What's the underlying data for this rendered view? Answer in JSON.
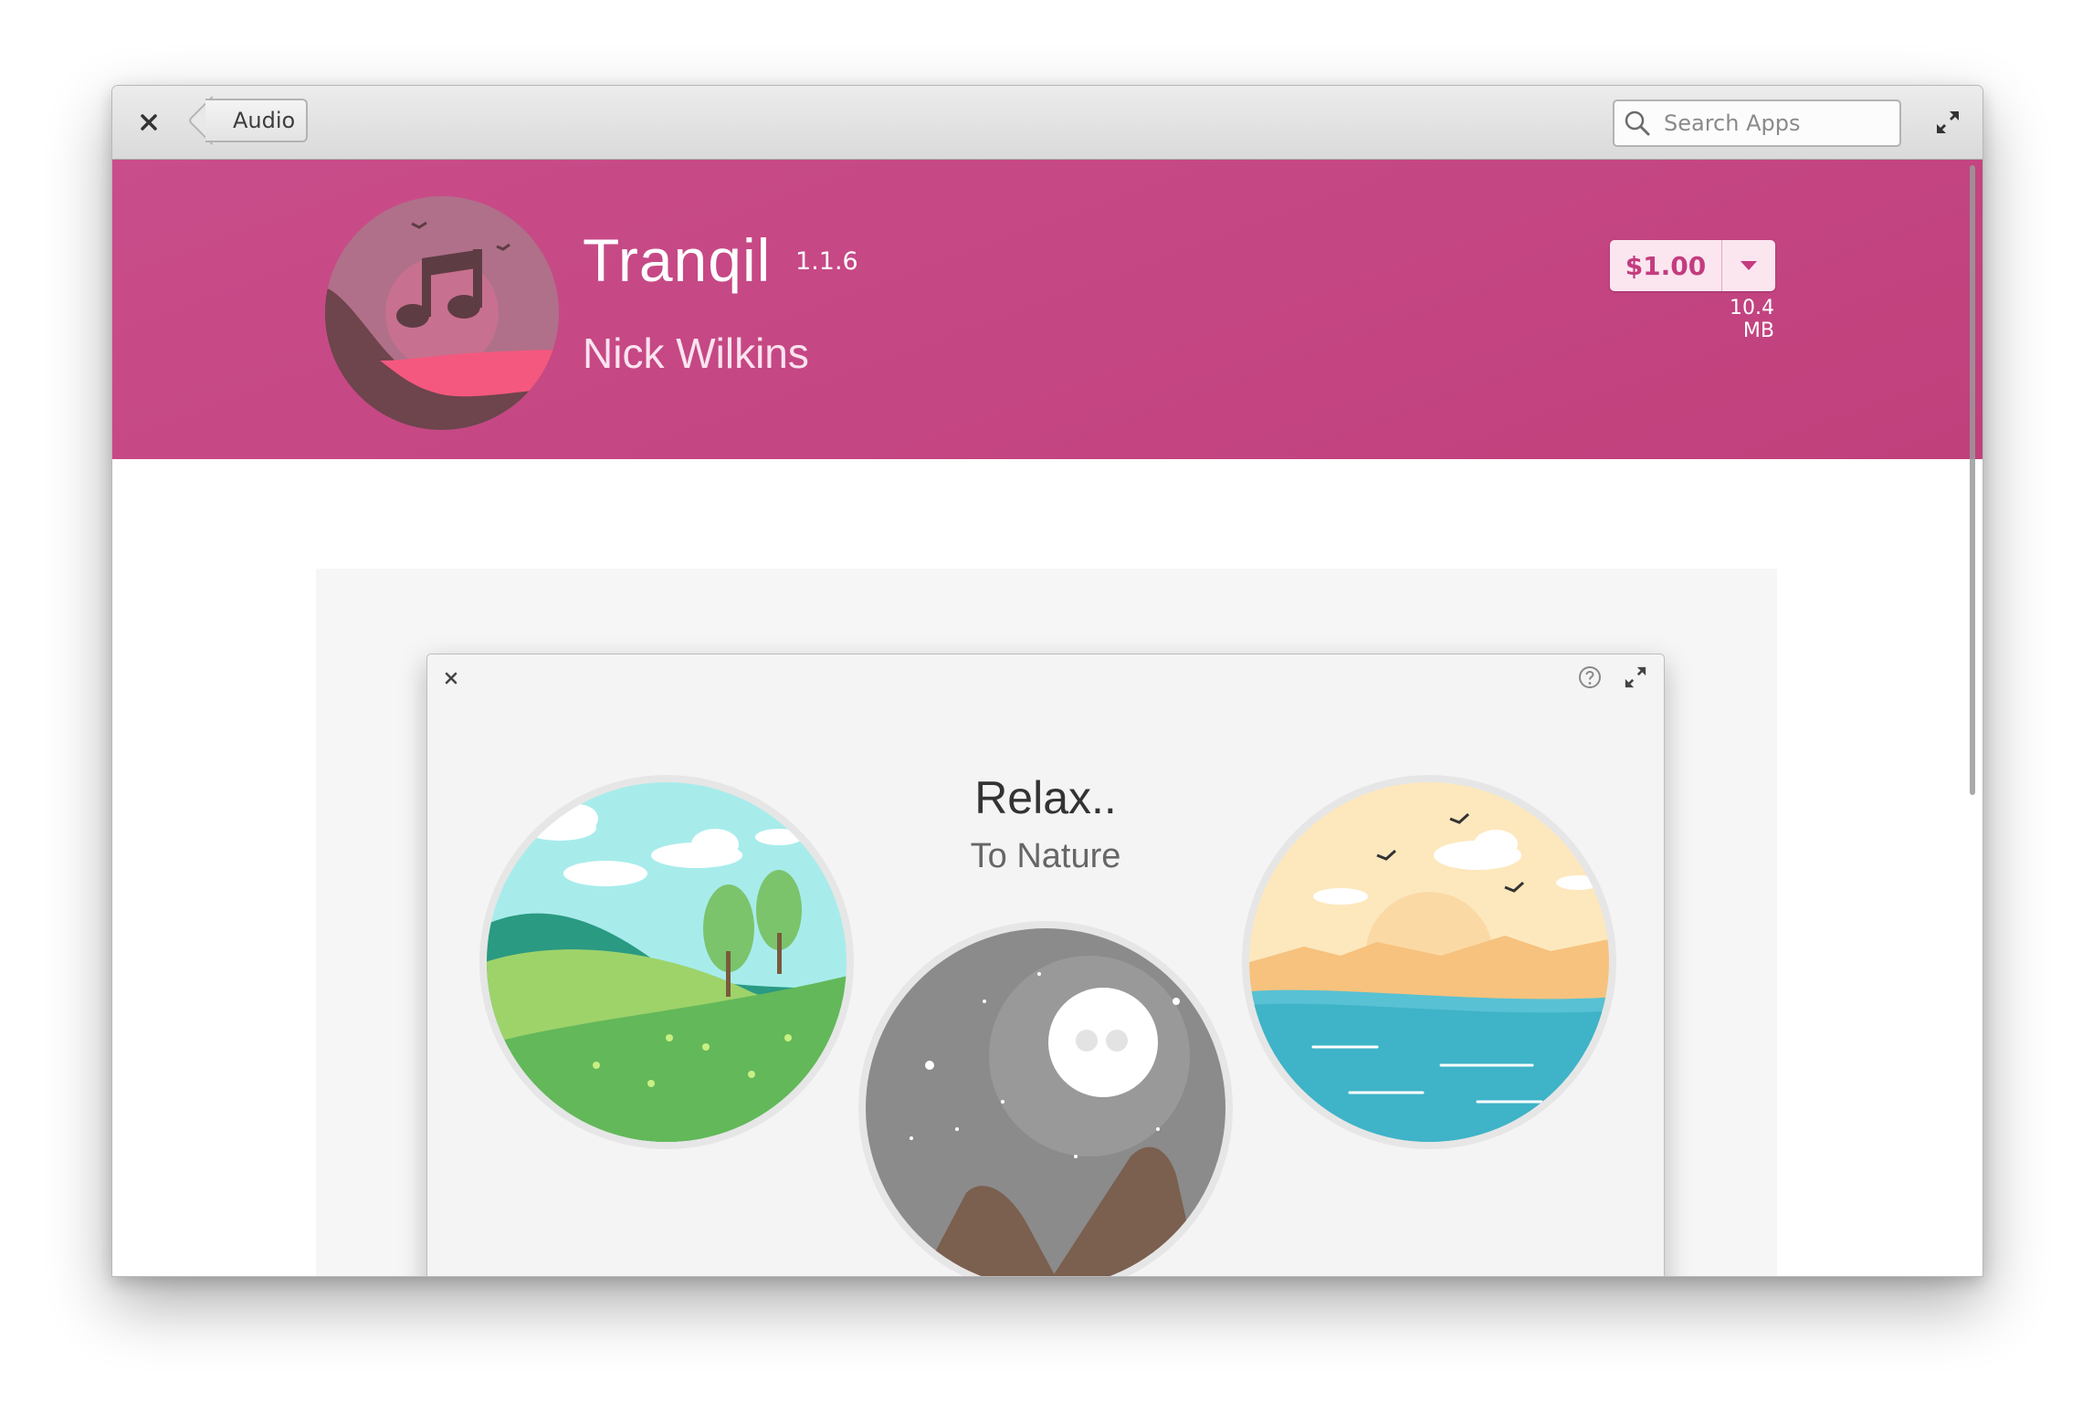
{
  "headerbar": {
    "back_label": "Audio",
    "search_placeholder": "Search Apps"
  },
  "app": {
    "name": "Tranqil",
    "version": "1.1.6",
    "author": "Nick Wilkins",
    "price": "$1.00",
    "size": "10.4 MB"
  },
  "screenshot": {
    "title": "Relax..",
    "subtitle": "To Nature"
  },
  "colors": {
    "banner_start": "#c94d8a",
    "banner_end": "#c0407c",
    "accent": "#c43c7e",
    "price_bg": "#fbe6f0"
  },
  "icons": [
    "close-icon",
    "maximize-icon",
    "search-icon",
    "chevron-down-icon",
    "help-icon"
  ]
}
